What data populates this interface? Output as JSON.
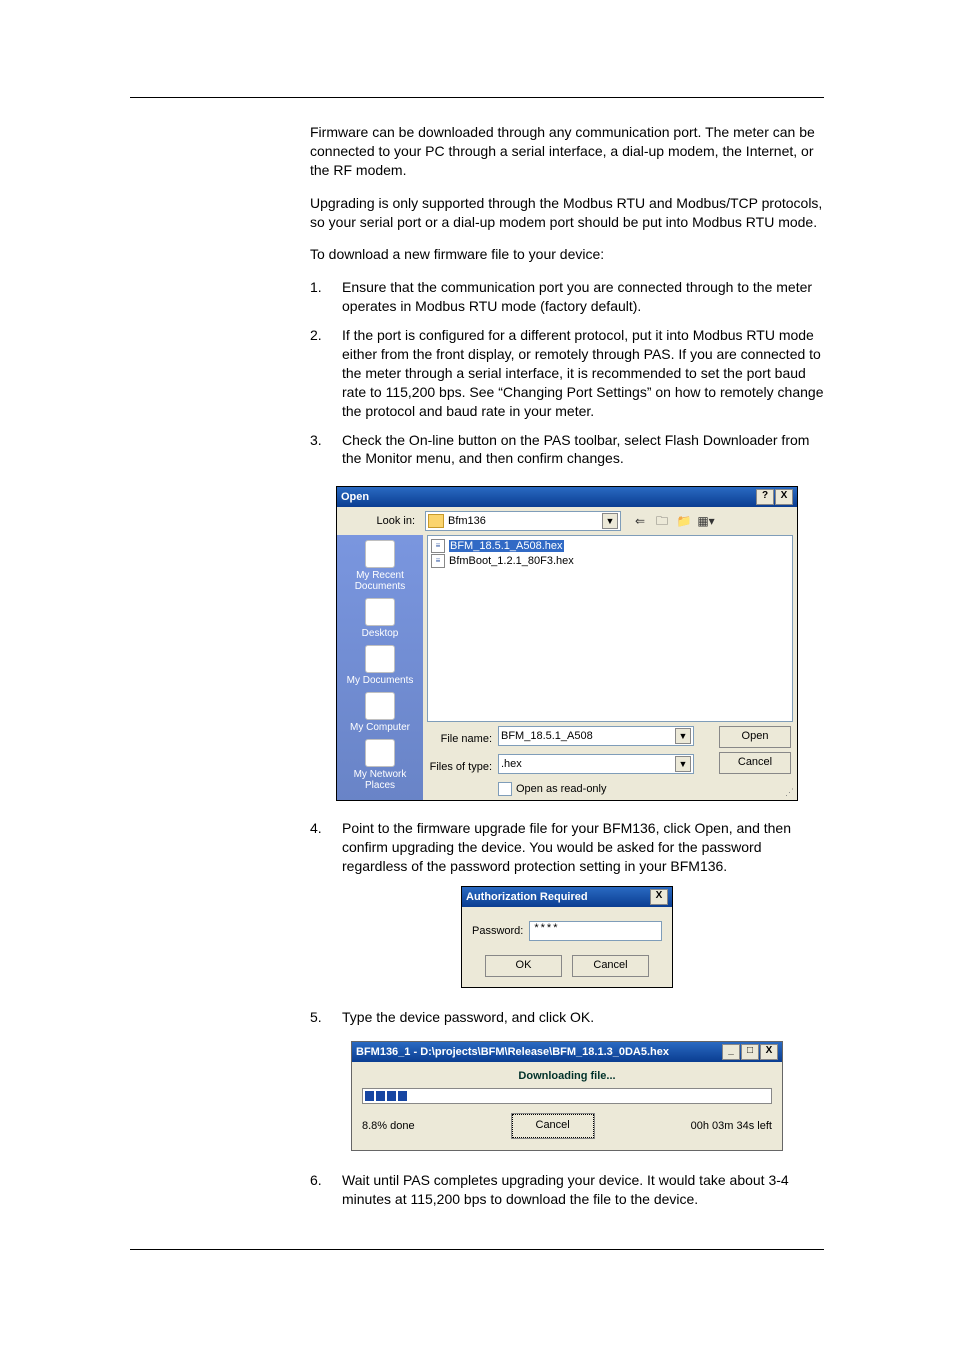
{
  "paragraphs": {
    "p1": "Firmware can be downloaded through any communication port. The meter can be connected to your PC through a serial interface, a dial-up modem, the Internet, or the RF modem.",
    "p2": "Upgrading is only supported through the Modbus RTU and Modbus/TCP protocols, so your serial port or a dial-up modem port should be put into Modbus RTU mode.",
    "p3": "To download a new firmware file to your device:"
  },
  "steps": {
    "s1": "Ensure that the communication port you are connected through to the meter operates in Modbus RTU mode (factory default).",
    "s2": "If the port is configured for a different protocol, put it into Modbus RTU mode either from the front display, or remotely through PAS. If you are connected to the meter through a serial interface, it is recommended to set the port baud rate to 115,200 bps. See “Changing Port Settings” on how to remotely change the protocol and baud rate in your meter.",
    "s3": "Check the On-line button on the PAS toolbar, select Flash Downloader from the Monitor menu, and then confirm changes.",
    "s4": "Point to the firmware upgrade file for your BFM136, click Open, and then confirm upgrading the device. You would be asked for the password regardless of the password protection setting in your BFM136.",
    "s5": "Type the device password, and click OK.",
    "s6": "Wait until PAS completes upgrading your device. It would take about 3-4 minutes at 115,200 bps to download the file to the device."
  },
  "open_dialog": {
    "title": "Open",
    "help_btn": "?",
    "close_btn": "X",
    "look_in_label": "Look in:",
    "folder": "Bfm136",
    "files": [
      "BFM_18.5.1_A508.hex",
      "BfmBoot_1.2.1_80F3.hex"
    ],
    "places": [
      "My Recent Documents",
      "Desktop",
      "My Documents",
      "My Computer",
      "My Network Places"
    ],
    "file_name_label": "File name:",
    "file_name_value": "BFM_18.5.1_A508",
    "files_of_type_label": "Files of type:",
    "files_of_type_value": ".hex",
    "readonly_label": "Open as read-only",
    "open_btn": "Open",
    "cancel_btn": "Cancel"
  },
  "auth_dialog": {
    "title": "Authorization Required",
    "close_btn": "X",
    "password_label": "Password:",
    "password_value": "****",
    "ok_btn": "OK",
    "cancel_btn": "Cancel"
  },
  "dl_dialog": {
    "title": "BFM136_1 - D:\\projects\\BFM\\Release\\BFM_18.1.3_0DA5.hex",
    "min_btn": "_",
    "max_btn": "□",
    "close_btn": "X",
    "heading": "Downloading file...",
    "percent": "8.8% done",
    "cancel_btn": "Cancel",
    "time_left": "00h 03m 34s left"
  }
}
